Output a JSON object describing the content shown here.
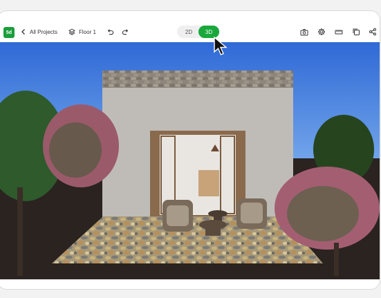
{
  "toolbar": {
    "logo_text": "5d",
    "back_label": "All Projects",
    "floor_label": "Floor 1",
    "view_2d": "2D",
    "view_3d": "3D",
    "active_view": "3D",
    "accent_color": "#1aa83c",
    "icons": [
      "chevron-left-icon",
      "layers-icon",
      "undo-icon",
      "redo-icon",
      "camera-icon",
      "gear-icon",
      "ruler-icon",
      "copy-icon",
      "share-icon"
    ]
  }
}
